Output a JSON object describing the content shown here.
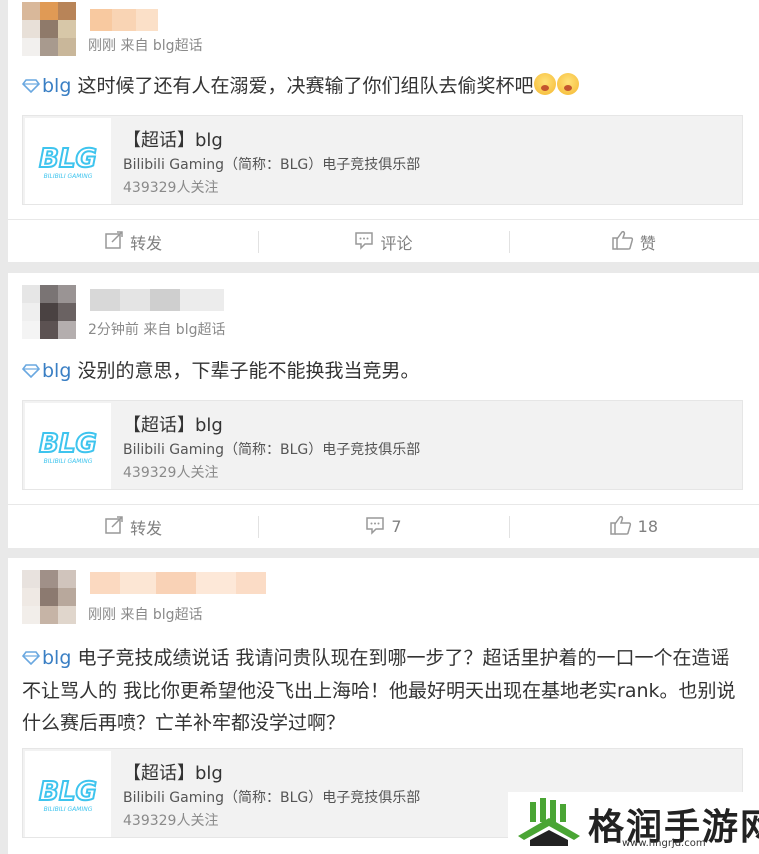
{
  "posts": [
    {
      "meta": "刚刚 来自 blg超话",
      "topic": "blg",
      "text": " 这时候了还有人在溺爱，决赛输了你们组队去偷奖杯吧",
      "emoji": [
        "scream-emoji",
        "scream-emoji"
      ],
      "card": {
        "title": "【超话】blg",
        "desc": "Bilibili Gaming（简称：BLG）电子竞技俱乐部",
        "fans": "439329人关注"
      },
      "actions": {
        "repost": "转发",
        "comment": "评论",
        "like": "赞"
      }
    },
    {
      "meta": "2分钟前 来自 blg超话",
      "topic": "blg",
      "text": " 没别的意思，下辈子能不能换我当竞男。",
      "card": {
        "title": "【超话】blg",
        "desc": "Bilibili Gaming（简称：BLG）电子竞技俱乐部",
        "fans": "439329人关注"
      },
      "actions": {
        "repost": "转发",
        "comment": "7",
        "like": "18"
      }
    },
    {
      "meta": "刚刚 来自 blg超话",
      "topic": "blg",
      "text": " 电子竞技成绩说话 我请问贵队现在到哪一步了？超话里护着的一口一个在造谣不让骂人的 我比你更希望他没飞出上海哈！他最好明天出现在基地老实rank。也别说什么赛后再喷？亡羊补牢都没学过啊？",
      "card": {
        "title": "【超话】blg",
        "desc": "Bilibili Gaming（简称：BLG）电子竞技俱乐部",
        "fans": "439329人关注"
      }
    }
  ],
  "card_logo": {
    "main": "BLG",
    "sub": "BILIBILI GAMING"
  },
  "watermark": {
    "name": "格润手游网",
    "url": "www.hngrjd.com"
  },
  "colors": {
    "topic": "#3a7fc4",
    "logo": "#3ec4ee",
    "watermark_green": "#4aa534"
  }
}
